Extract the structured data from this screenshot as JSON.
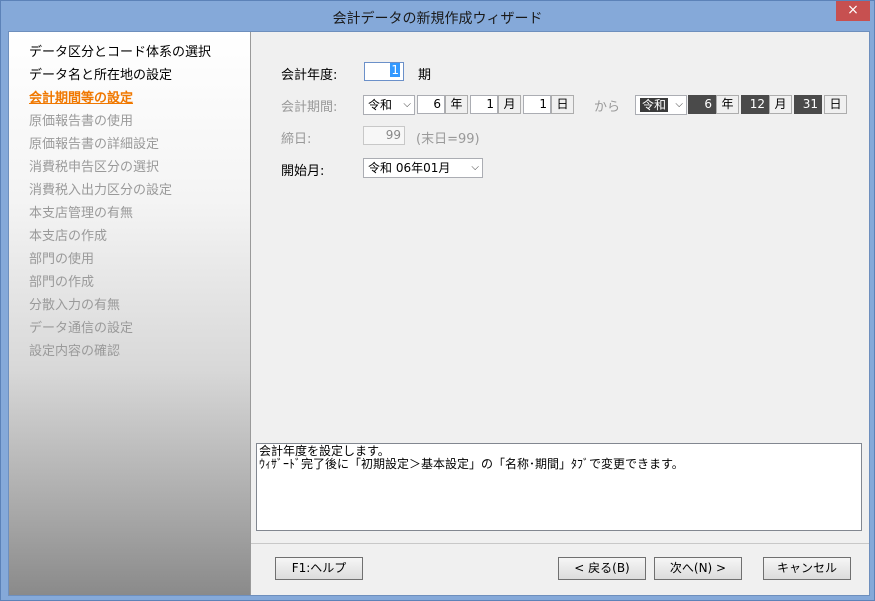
{
  "window": {
    "title": "会計データの新規作成ウィザード",
    "close_glyph": "×"
  },
  "steps": [
    {
      "label": "データ区分とコード体系の選択",
      "state": "done"
    },
    {
      "label": "データ名と所在地の設定",
      "state": "done"
    },
    {
      "label": "会計期間等の設定",
      "state": "current"
    },
    {
      "label": "原価報告書の使用",
      "state": "pending"
    },
    {
      "label": "原価報告書の詳細設定",
      "state": "pending"
    },
    {
      "label": "消費税申告区分の選択",
      "state": "pending"
    },
    {
      "label": "消費税入出力区分の設定",
      "state": "pending"
    },
    {
      "label": "本支店管理の有無",
      "state": "pending"
    },
    {
      "label": "本支店の作成",
      "state": "pending"
    },
    {
      "label": "部門の使用",
      "state": "pending"
    },
    {
      "label": "部門の作成",
      "state": "pending"
    },
    {
      "label": "分散入力の有無",
      "state": "pending"
    },
    {
      "label": "データ通信の設定",
      "state": "pending"
    },
    {
      "label": "設定内容の確認",
      "state": "pending"
    }
  ],
  "form": {
    "fiscal_year": {
      "label": "会計年度:",
      "value": "1",
      "suffix": "期"
    },
    "period": {
      "label": "会計期間:",
      "start": {
        "era": "令和",
        "year": "6",
        "year_unit": "年",
        "month": "1",
        "month_unit": "月",
        "day": "1",
        "day_unit": "日"
      },
      "from": "から",
      "end": {
        "era": "令和",
        "year": "6",
        "year_unit": "年",
        "month": "12",
        "month_unit": "月",
        "day": "31",
        "day_unit": "日"
      }
    },
    "closing_day": {
      "label": "締日:",
      "value": "99",
      "hint": "(末日=99)"
    },
    "start_month": {
      "label": "開始月:",
      "value": "令和 06年01月"
    }
  },
  "description": {
    "line1": "会計年度を設定します。",
    "line2": "ｳｨｻﾞｰﾄﾞ完了後に「初期設定＞基本設定」の「名称･期間」ﾀﾌﾞで変更できます。"
  },
  "buttons": {
    "help": "F1:ヘルプ",
    "back": "< 戻る(B)",
    "next": "次へ(N) >",
    "cancel": "キャンセル"
  }
}
